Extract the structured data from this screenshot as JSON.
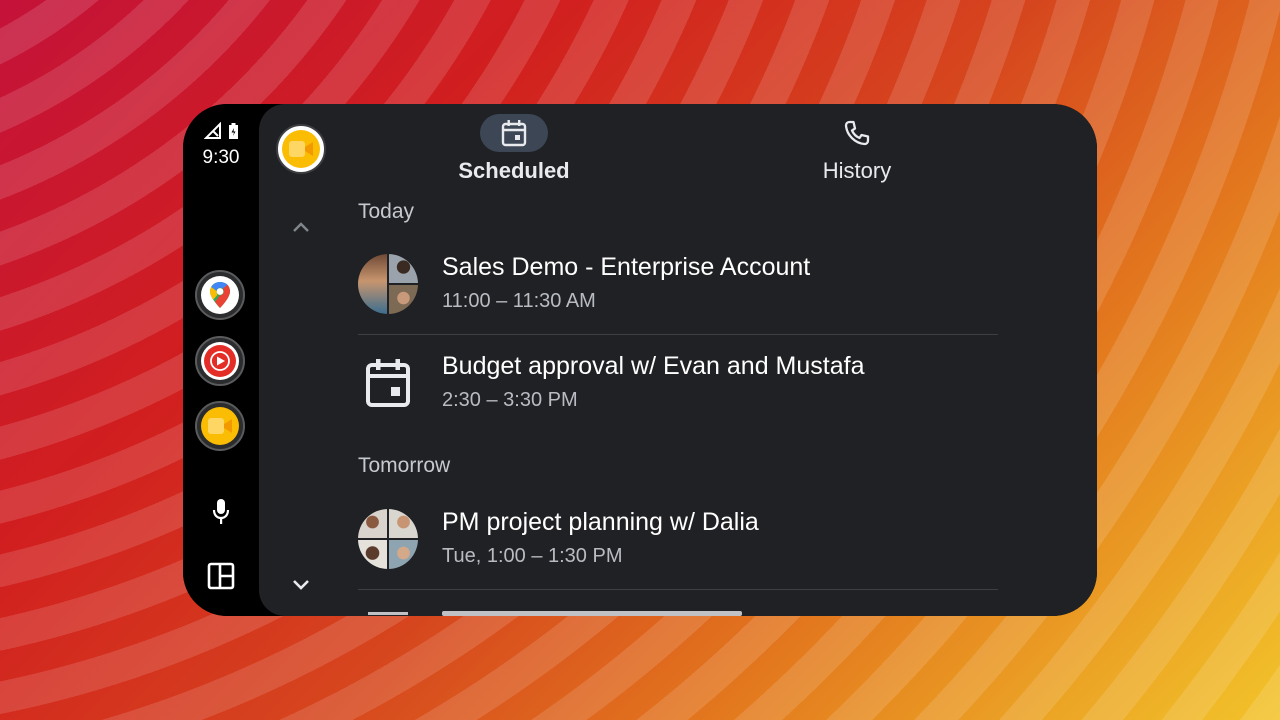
{
  "status_bar": {
    "time": "9:30"
  },
  "rail": {
    "apps": [
      {
        "name": "Maps"
      },
      {
        "name": "YouTube Music"
      },
      {
        "name": "Meet"
      }
    ]
  },
  "tabs": [
    {
      "label": "Scheduled",
      "icon": "calendar-icon",
      "active": true
    },
    {
      "label": "History",
      "icon": "phone-icon",
      "active": false
    }
  ],
  "sections": [
    {
      "heading": "Today",
      "items": [
        {
          "title": "Sales Demo - Enterprise Account",
          "time": "11:00 – 11:30 AM",
          "avatar": "group-photo"
        },
        {
          "title": "Budget approval w/ Evan and Mustafa",
          "time": "2:30 – 3:30 PM",
          "avatar": "calendar-icon"
        }
      ]
    },
    {
      "heading": "Tomorrow",
      "items": [
        {
          "title": "PM project planning w/ Dalia",
          "time": "Tue, 1:00 – 1:30 PM",
          "avatar": "group-photo"
        }
      ]
    }
  ],
  "colors": {
    "panel_bg": "#202124",
    "active_tab_pill": "#3c4654",
    "meet_yellow": "#fbbc04"
  }
}
